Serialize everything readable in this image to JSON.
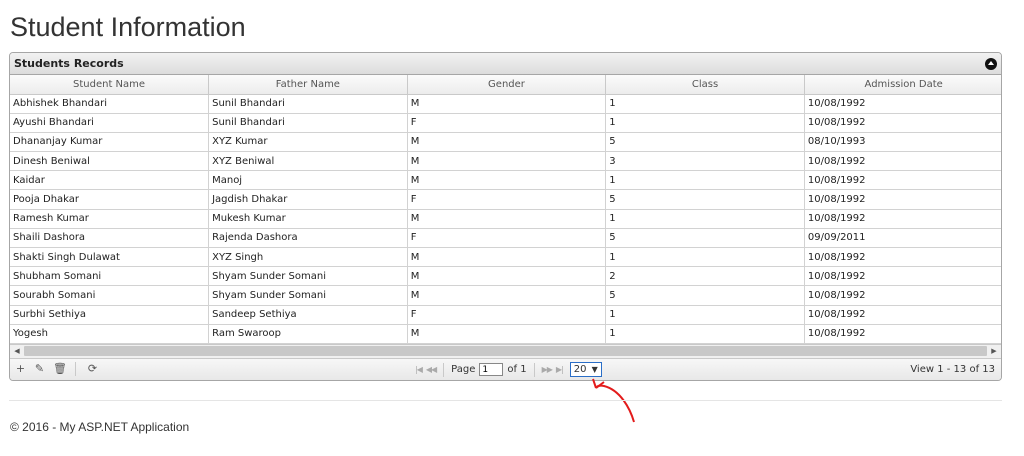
{
  "page": {
    "title": "Student Information"
  },
  "grid": {
    "caption": "Students Records",
    "columns": [
      "Student Name",
      "Father Name",
      "Gender",
      "Class",
      "Admission Date"
    ],
    "rows": [
      [
        "Abhishek Bhandari",
        "Sunil Bhandari",
        "M",
        "1",
        "10/08/1992"
      ],
      [
        "Ayushi Bhandari",
        "Sunil Bhandari",
        "F",
        "1",
        "10/08/1992"
      ],
      [
        "Dhananjay Kumar",
        "XYZ Kumar",
        "M",
        "5",
        "08/10/1993"
      ],
      [
        "Dinesh Beniwal",
        "XYZ Beniwal",
        "M",
        "3",
        "10/08/1992"
      ],
      [
        "Kaidar",
        "Manoj",
        "M",
        "1",
        "10/08/1992"
      ],
      [
        "Pooja Dhakar",
        "Jagdish Dhakar",
        "F",
        "5",
        "10/08/1992"
      ],
      [
        "Ramesh Kumar",
        "Mukesh Kumar",
        "M",
        "1",
        "10/08/1992"
      ],
      [
        "Shaili Dashora",
        "Rajenda Dashora",
        "F",
        "5",
        "09/09/2011"
      ],
      [
        "Shakti Singh Dulawat",
        "XYZ Singh",
        "M",
        "1",
        "10/08/1992"
      ],
      [
        "Shubham Somani",
        "Shyam Sunder Somani",
        "M",
        "2",
        "10/08/1992"
      ],
      [
        "Sourabh Somani",
        "Shyam Sunder Somani",
        "M",
        "5",
        "10/08/1992"
      ],
      [
        "Surbhi Sethiya",
        "Sandeep Sethiya",
        "F",
        "1",
        "10/08/1992"
      ],
      [
        "Yogesh",
        "Ram Swaroop",
        "M",
        "1",
        "10/08/1992"
      ]
    ]
  },
  "pager": {
    "actions": [
      {
        "name": "add-icon",
        "glyph": "+"
      },
      {
        "name": "edit-icon",
        "glyph": "✎"
      },
      {
        "name": "delete-icon",
        "glyph": "🗑"
      },
      {
        "name": "refresh-icon",
        "glyph": "⟳"
      }
    ],
    "first_glyph": "|◀",
    "prev_glyph": "◀◀",
    "next_glyph": "▶▶",
    "last_glyph": "▶|",
    "page_label": "Page",
    "page_value": "1",
    "of_label": "of 1",
    "rows_per_page": "20",
    "select_arrow": "▼",
    "view_text": "View 1 - 13 of 13"
  },
  "annotation_color": "#e31b1b",
  "footer": {
    "text": "© 2016 - My ASP.NET Application"
  }
}
